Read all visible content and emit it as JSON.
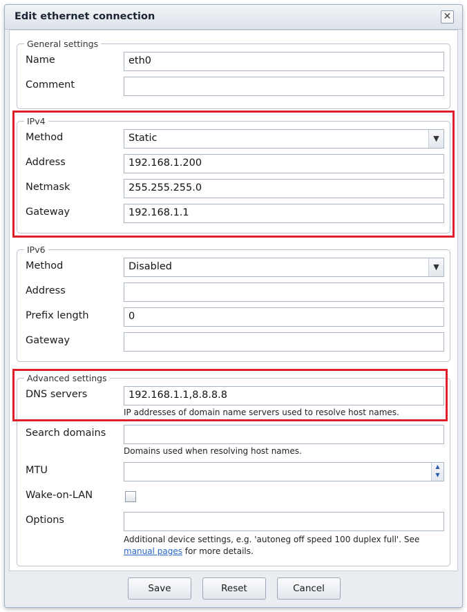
{
  "dialog": {
    "title": "Edit ethernet connection"
  },
  "general": {
    "legend": "General settings",
    "name_label": "Name",
    "name_value": "eth0",
    "comment_label": "Comment",
    "comment_value": ""
  },
  "ipv4": {
    "legend": "IPv4",
    "method_label": "Method",
    "method_value": "Static",
    "address_label": "Address",
    "address_value": "192.168.1.200",
    "netmask_label": "Netmask",
    "netmask_value": "255.255.255.0",
    "gateway_label": "Gateway",
    "gateway_value": "192.168.1.1"
  },
  "ipv6": {
    "legend": "IPv6",
    "method_label": "Method",
    "method_value": "Disabled",
    "address_label": "Address",
    "address_value": "",
    "prefix_label": "Prefix length",
    "prefix_value": "0",
    "gateway_label": "Gateway",
    "gateway_value": ""
  },
  "advanced": {
    "legend": "Advanced settings",
    "dns_label": "DNS servers",
    "dns_value": "192.168.1.1,8.8.8.8",
    "dns_hint": "IP addresses of domain name servers used to resolve host names.",
    "search_label": "Search domains",
    "search_value": "",
    "search_hint": "Domains used when resolving host names.",
    "mtu_label": "MTU",
    "mtu_value": "",
    "wol_label": "Wake-on-LAN",
    "wol_checked": false,
    "options_label": "Options",
    "options_value": "",
    "options_hint_1": "Additional device settings, e.g. 'autoneg off speed 100 duplex full'. See",
    "options_hint_link": "manual pages",
    "options_hint_2": " for more details."
  },
  "buttons": {
    "save": "Save",
    "reset": "Reset",
    "cancel": "Cancel"
  },
  "colors": {
    "highlight": "#e01e2b",
    "link": "#2a66c8"
  },
  "icons": {
    "close": "close-icon",
    "dropdown": "chevron-down-icon",
    "spinner": "spinner-arrows-icon",
    "checkbox": "checkbox-icon"
  }
}
